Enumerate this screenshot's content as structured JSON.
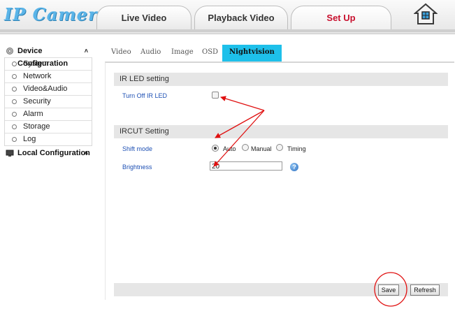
{
  "header": {
    "logo_text": "IP Camera",
    "tabs": [
      {
        "label": "Live Video"
      },
      {
        "label": "Playback Video"
      },
      {
        "label": "Set Up"
      }
    ],
    "active_tab_color": "#c8102e"
  },
  "sidebar": {
    "device_config_label": "Device Configuration",
    "device_items": [
      {
        "label": "System"
      },
      {
        "label": "Network"
      },
      {
        "label": "Video&Audio"
      },
      {
        "label": "Security"
      },
      {
        "label": "Alarm"
      },
      {
        "label": "Storage"
      },
      {
        "label": "Log"
      }
    ],
    "local_config_label": "Local Configuration",
    "caret": "˄"
  },
  "subtabs": [
    {
      "label": "Video"
    },
    {
      "label": "Audio"
    },
    {
      "label": "Image"
    },
    {
      "label": "OSD"
    },
    {
      "label": "Nightvision",
      "active": true
    }
  ],
  "ir_section": {
    "title": "IR LED setting",
    "turn_off_label": "Turn Off IR LED",
    "turn_off_checked": false
  },
  "ircut_section": {
    "title": "IRCUT Setting",
    "shift_mode_label": "Shift mode",
    "shift_mode_options": [
      "Auto",
      "Manual",
      "Timing"
    ],
    "shift_mode_selected": "Auto",
    "brightness_label": "Brightness",
    "brightness_value": "20",
    "help_glyph": "?"
  },
  "footer": {
    "save_label": "Save",
    "refresh_label": "Refresh"
  },
  "annotation_color": "#e01010"
}
